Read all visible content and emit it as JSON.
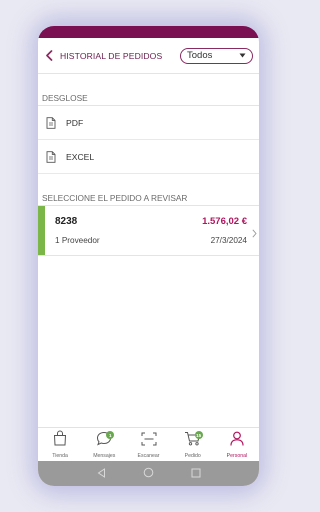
{
  "header": {
    "title": "HISTORIAL DE PEDIDOS",
    "filter_value": "Todos"
  },
  "breakdown": {
    "section_label": "DESGLOSE",
    "options": [
      {
        "label": "PDF",
        "icon": "document-icon"
      },
      {
        "label": "EXCEL",
        "icon": "document-icon"
      }
    ]
  },
  "orders": {
    "section_label": "SELECCIONE EL PEDIDO A REVISAR",
    "items": [
      {
        "id": "8238",
        "amount": "1.576,02 €",
        "suppliers": "1 Proveedor",
        "date": "27/3/2024",
        "status_color": "#7ab648"
      }
    ]
  },
  "tabbar": {
    "tabs": [
      {
        "label": "Tienda",
        "icon": "shopping-bag-icon",
        "active": false
      },
      {
        "label": "Mensajes",
        "icon": "chat-bubble-icon",
        "active": false,
        "badge": "1"
      },
      {
        "label": "Escanear",
        "icon": "scan-icon",
        "active": false
      },
      {
        "label": "Pedido",
        "icon": "cart-icon",
        "active": false,
        "badge": "15"
      },
      {
        "label": "Personal",
        "icon": "person-icon",
        "active": true
      }
    ]
  },
  "colors": {
    "brand": "#7a0f52",
    "accent": "#b0165f",
    "status_green": "#7ab648"
  }
}
